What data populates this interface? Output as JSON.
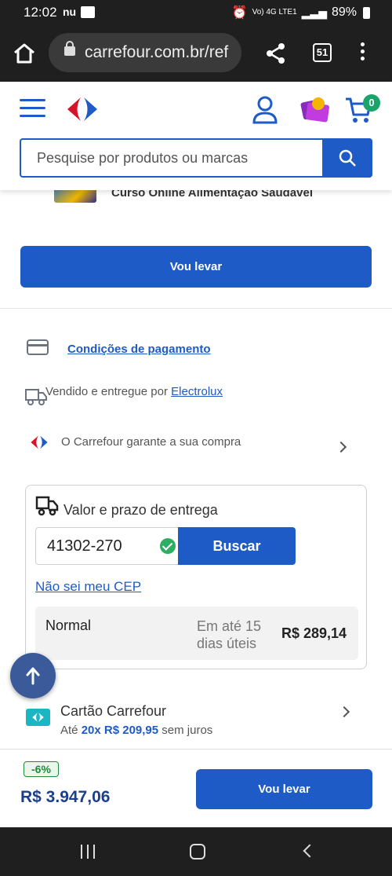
{
  "status_bar": {
    "time": "12:02",
    "nu_label": "nu",
    "network": "Vo) 4G LTE1",
    "battery": "89%"
  },
  "browser": {
    "url": "carrefour.com.br/ref",
    "tab_count": "51"
  },
  "header": {
    "cart_count": "0",
    "search_placeholder": "Pesquise por produtos ou marcas"
  },
  "product": {
    "course_title": "Curso Online Alimentação Saudável",
    "cta_label": "Vou levar"
  },
  "info": {
    "payment_link": "Condições de pagamento",
    "sold_prefix": "Vendido e entregue por",
    "seller": "Electrolux",
    "guarantee": "O Carrefour garante a sua compra"
  },
  "delivery": {
    "title": "Valor e prazo de entrega",
    "cep_value": "41302-270",
    "search_button": "Buscar",
    "unknown_cep_link": "Não sei meu CEP",
    "option_name": "Normal",
    "option_deadline": "Em até 15 dias úteis",
    "option_price": "R$ 289,14"
  },
  "card_offer": {
    "title": "Cartão Carrefour",
    "prefix": "Até",
    "installments": "20x R$ 209,95",
    "suffix": "sem juros"
  },
  "bottom": {
    "discount": "-6%",
    "price": "R$ 3.947,06",
    "cta_label": "Vou levar"
  },
  "colors": {
    "brand_blue": "#1e5bc6",
    "success_green": "#2fae63",
    "price_navy": "#1b3f8a"
  }
}
